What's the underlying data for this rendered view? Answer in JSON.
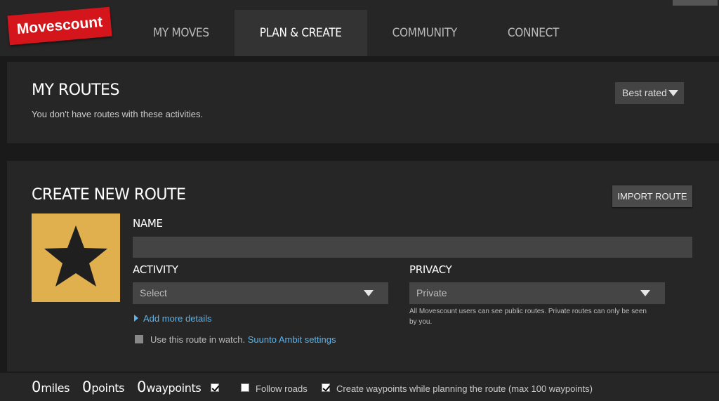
{
  "header": {
    "logo": "Movescount",
    "nav": [
      "MY MOVES",
      "PLAN & CREATE",
      "COMMUNITY",
      "CONNECT"
    ],
    "active_nav": "PLAN & CREATE"
  },
  "my_routes": {
    "title": "MY ROUTES",
    "message": "You don't have routes with these activities.",
    "sort_label": "Best rated"
  },
  "create_route": {
    "title": "CREATE NEW ROUTE",
    "import_label": "IMPORT ROUTE",
    "name_label": "NAME",
    "name_value": "",
    "activity_label": "ACTIVITY",
    "activity_value": "Select",
    "privacy_label": "PRIVACY",
    "privacy_value": "Private",
    "privacy_note": "All Movescount users can see public routes. Private routes can only be seen by you.",
    "add_details": "Add more details",
    "watch_text": "Use this route in watch.",
    "watch_link": "Suunto Ambit settings",
    "icon": "star-icon",
    "icon_bg": "#e0af4e"
  },
  "stats": {
    "miles_value": "0",
    "miles_unit": "miles",
    "points_value": "0",
    "points_unit": "points",
    "waypoints_value": "0",
    "waypoints_unit": "waypoints",
    "waypoints_checked": true,
    "follow_roads_label": "Follow roads",
    "follow_roads_checked": false,
    "create_waypoints_label": "Create waypoints while planning the route (max 100 waypoints)",
    "create_waypoints_checked": true
  },
  "colors": {
    "brand": "#d4161c",
    "link": "#5bb3ea"
  }
}
